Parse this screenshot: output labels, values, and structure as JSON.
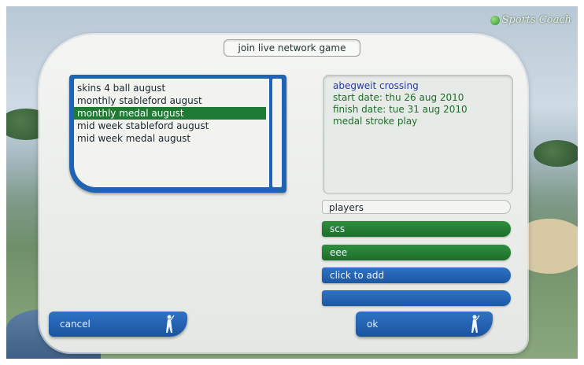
{
  "brand": "Sports Coach",
  "dialog": {
    "title": "join live network game"
  },
  "games": {
    "items": [
      {
        "label": "skins 4 ball august",
        "selected": false
      },
      {
        "label": "monthly stableford august",
        "selected": false
      },
      {
        "label": "monthly medal august",
        "selected": true
      },
      {
        "label": "mid week stableford august",
        "selected": false
      },
      {
        "label": "mid week medal august",
        "selected": false
      }
    ]
  },
  "details": {
    "course": "abegweit crossing",
    "start": "start date: thu 26 aug 2010",
    "finish": "finish date: tue 31 aug 2010",
    "format": "medal stroke play"
  },
  "players": {
    "label": "players",
    "slots": [
      {
        "text": "scs",
        "state": "filled"
      },
      {
        "text": "eee",
        "state": "filled"
      },
      {
        "text": "click to add",
        "state": "empty"
      },
      {
        "text": "",
        "state": "empty"
      }
    ]
  },
  "buttons": {
    "cancel": "cancel",
    "ok": "ok"
  },
  "colors": {
    "accent_blue": "#1f63b4",
    "accent_green": "#1f7a33",
    "course_text": "#2a3aa0",
    "detail_text": "#1f6c2a"
  }
}
